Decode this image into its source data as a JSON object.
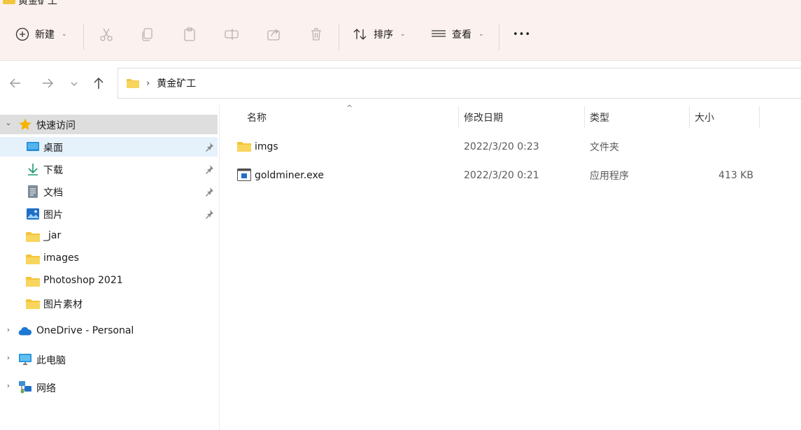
{
  "window": {
    "title": "黄金矿工"
  },
  "toolbar": {
    "new_label": "新建",
    "sort_label": "排序",
    "view_label": "查看",
    "more_label": "•••"
  },
  "navigation": {
    "address_segments": [
      "黄金矿工"
    ],
    "address_separator": "›"
  },
  "sidebar": {
    "quick_access": {
      "label": "快速访问",
      "expander": "⌄"
    },
    "pinned_items": [
      {
        "label": "桌面",
        "icon": "desktop-icon"
      },
      {
        "label": "下载",
        "icon": "download-icon"
      },
      {
        "label": "文档",
        "icon": "document-icon"
      },
      {
        "label": "图片",
        "icon": "pictures-icon"
      }
    ],
    "recent_items": [
      {
        "label": "_jar",
        "icon": "folder-icon"
      },
      {
        "label": "images",
        "icon": "folder-icon"
      },
      {
        "label": "Photoshop 2021",
        "icon": "folder-icon"
      },
      {
        "label": "图片素材",
        "icon": "folder-icon"
      }
    ],
    "roots": [
      {
        "label": "OneDrive - Personal",
        "icon": "onedrive-cloud-icon",
        "expander": "›"
      },
      {
        "label": "此电脑",
        "icon": "this-pc-icon",
        "expander": "›"
      },
      {
        "label": "网络",
        "icon": "network-icon",
        "expander": "›"
      }
    ]
  },
  "file_list": {
    "sort_indicator": "^",
    "columns": [
      "名称",
      "修改日期",
      "类型",
      "大小"
    ],
    "rows": [
      {
        "name": "imgs",
        "modified": "2022/3/20 0:23",
        "type": "文件夹",
        "size": "",
        "icon": "folder-icon"
      },
      {
        "name": "goldminer.exe",
        "modified": "2022/3/20 0:21",
        "type": "应用程序",
        "size": "413 KB",
        "icon": "application-icon"
      }
    ]
  },
  "colors": {
    "toolbar_bg": "#fbf1ee",
    "selection_bg": "#e5f1fb",
    "quick_access_bg": "#dedede",
    "folder_yellow": "#f3c53b",
    "accent_blue": "#1f6fc5"
  }
}
